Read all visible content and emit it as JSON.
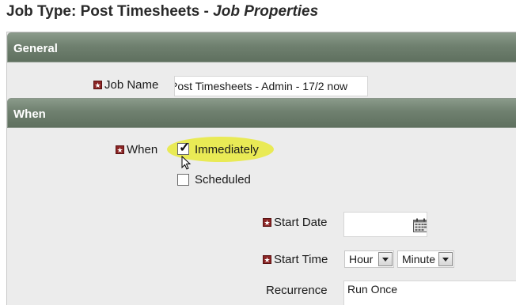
{
  "page": {
    "title_prefix": "Job Type: Post Timesheets - ",
    "title_italic": "Job Properties"
  },
  "sections": {
    "general": "General",
    "when": "When"
  },
  "fields": {
    "job_name_label": "Job Name",
    "job_name_value": "Post Timesheets - Admin - 17/2  now",
    "when_label": "When",
    "immediately_label": "Immediately",
    "immediately_checked": true,
    "scheduled_label": "Scheduled",
    "scheduled_checked": false,
    "start_date_label": "Start Date",
    "start_date_value": "",
    "start_time_label": "Start Time",
    "hour_value": "Hour",
    "minute_value": "Minute",
    "recurrence_label": "Recurrence",
    "recurrence_value": "Run Once"
  },
  "colors": {
    "section_header": "#6f806f",
    "required_marker": "#8b2525",
    "highlight": "#e9ea55"
  },
  "icons": {
    "required": "star-marker-icon",
    "calendar": "calendar-icon",
    "cursor": "mouse-pointer-icon"
  }
}
